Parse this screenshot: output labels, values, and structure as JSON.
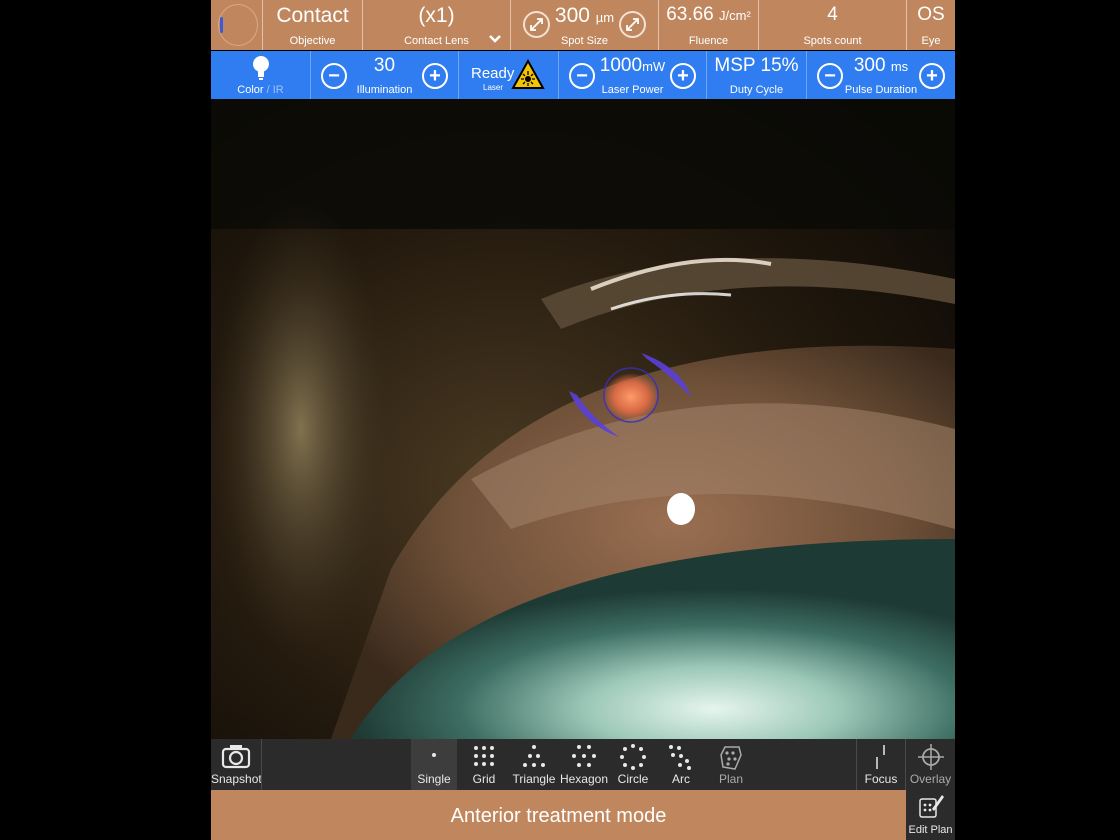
{
  "top": {
    "objective": {
      "value": "Contact",
      "label": "Objective"
    },
    "lens": {
      "value": "(x1)",
      "label": "Contact Lens"
    },
    "spot_size": {
      "value": "300",
      "unit": "µm",
      "label": "Spot Size"
    },
    "fluence": {
      "value": "63.66",
      "unit": "J/cm²",
      "label": "Fluence"
    },
    "spots": {
      "value": "4",
      "label": "Spots count"
    },
    "eye": {
      "value": "OS",
      "label": "Eye"
    }
  },
  "blue": {
    "color_label_a": "Color",
    "color_label_b": " / IR",
    "illumination": {
      "value": "30",
      "label": "Illumination"
    },
    "laser": {
      "value": "Ready",
      "label": "Laser"
    },
    "power": {
      "value": "1000",
      "unit": "mW",
      "label": "Laser Power"
    },
    "duty": {
      "value": "MSP 15%",
      "label": "Duty Cycle"
    },
    "pulse": {
      "value": "300",
      "unit": "ms",
      "label": "Pulse Duration"
    }
  },
  "toolbar": {
    "snapshot": "Snapshot",
    "patterns": [
      "Single",
      "Grid",
      "Triangle",
      "Hexagon",
      "Circle",
      "Arc",
      "Plan"
    ],
    "focus": "Focus",
    "overlay": "Overlay",
    "edit_plan": "Edit Plan"
  },
  "status": "Anterior treatment mode",
  "colors": {
    "accent": "#c0875e",
    "blue": "#2f7df0",
    "toolbar": "#2b2b2b",
    "aim": "#5a40d8"
  }
}
